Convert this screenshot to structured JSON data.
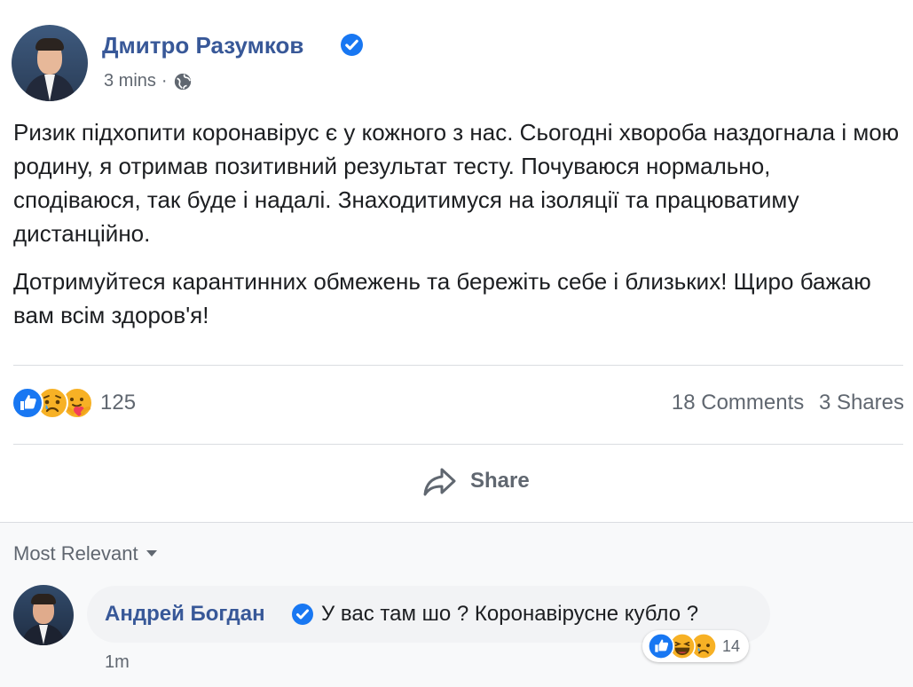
{
  "post": {
    "author": "Дмитро Разумков",
    "time": "3 mins",
    "dot": "·",
    "paragraphs": [
      "Ризик підхопити коронавірус є у кожного з нас. Сьогодні хвороба наздогнала і мою родину, я отримав позитивний результат тесту. Почуваюся нормально, сподіваюся, так буде і надалі. Знаходитимуся на ізоляції та працюватиму дистанційно.",
      "Дотримуйтеся карантинних обмежень та бережіть себе і близьких! Щиро бажаю вам всім здоров'я!"
    ]
  },
  "reactions": {
    "icons": [
      "like-icon",
      "sad-icon",
      "care-icon"
    ],
    "count": "125",
    "comments": "18 Comments",
    "shares": "3 Shares"
  },
  "actions": {
    "share_label": "Share"
  },
  "comments_section": {
    "sort_label": "Most Relevant"
  },
  "comment": {
    "author": "Андрей Богдан",
    "text": "У вас там шо ? Коронавірусне кубло ?",
    "time": "1m",
    "reaction_icons": [
      "like-icon",
      "haha-icon",
      "sad-icon"
    ],
    "reaction_count": "14"
  },
  "colors": {
    "link": "#385898",
    "like": "#1877f2",
    "secondary": "#606770"
  }
}
